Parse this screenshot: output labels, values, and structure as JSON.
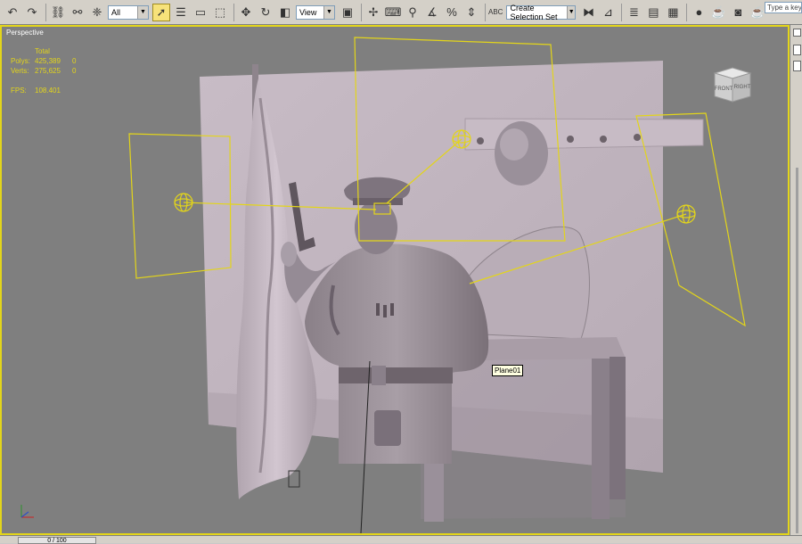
{
  "toolbar": {
    "selection_filter": "All",
    "reference_coord": "View",
    "named_selection": "Create Selection Set",
    "abc_label": "ABC"
  },
  "search": {
    "placeholder": "Type a keyword"
  },
  "viewport": {
    "label": "Perspective",
    "stats": {
      "header": "Total",
      "polys_label": "Polys:",
      "polys_total": "425,389",
      "polys_sel": "0",
      "verts_label": "Verts:",
      "verts_total": "275,625",
      "verts_sel": "0",
      "fps_label": "FPS:",
      "fps_value": "108.401"
    },
    "tooltip": "Plane01",
    "viewcube": {
      "front": "FRONT",
      "right": "RIGHT"
    }
  },
  "timeline": {
    "frame": "0 / 100"
  },
  "colors": {
    "selection": "#e3d51a",
    "viewport_bg": "#7f7f7f",
    "ui_gray": "#d4d0c8"
  }
}
